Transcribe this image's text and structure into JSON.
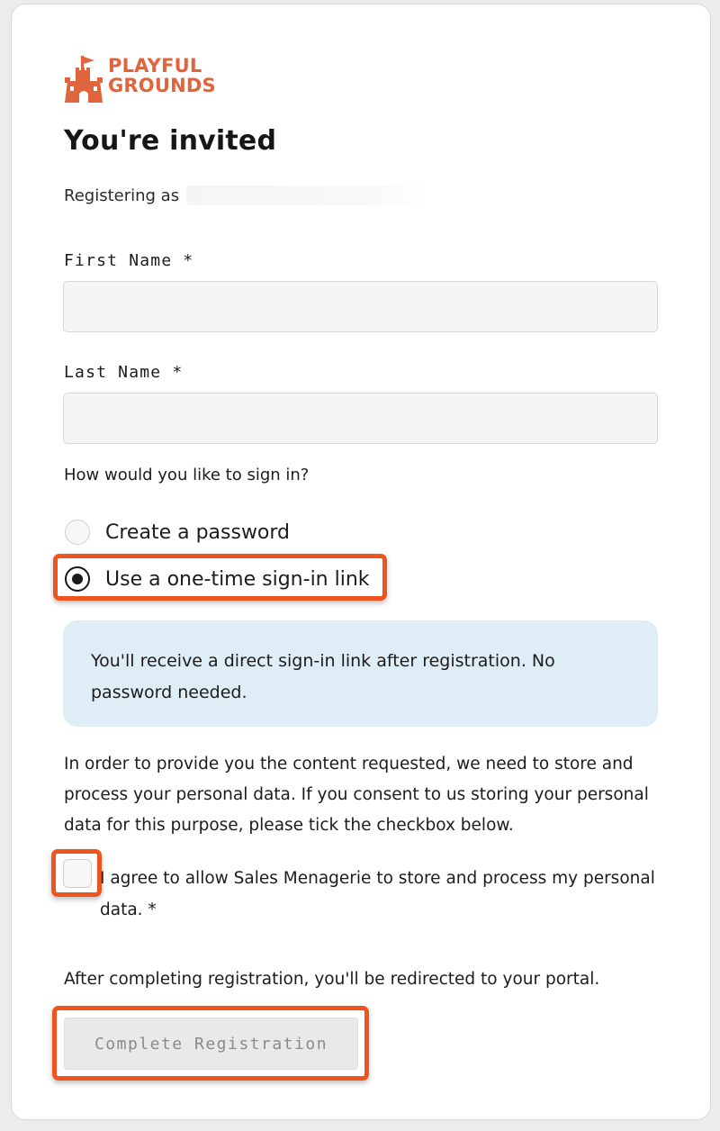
{
  "brand": {
    "logo_line1": "PLAYFUL",
    "logo_line2": "GROUNDS",
    "color": "#e0643c",
    "logo_icon": "castle-flag-icon"
  },
  "header": {
    "title": "You're invited",
    "registering_as_label": "Registering as"
  },
  "form": {
    "first_name": {
      "label": "First Name *",
      "value": "",
      "placeholder": ""
    },
    "last_name": {
      "label": "Last Name *",
      "value": "",
      "placeholder": ""
    },
    "signin_question": "How would you like to sign in?",
    "signin_options": [
      {
        "label": "Create a password",
        "selected": false
      },
      {
        "label": "Use a one-time sign-in link",
        "selected": true
      }
    ],
    "info_message": "You'll receive a direct sign-in link after registration. No password needed.",
    "consent_text": "In order to provide you the content requested, we need to store and process your personal data. If you consent to us storing your personal data for this purpose, please tick the checkbox below.",
    "consent_checkbox_label": "I agree to allow Sales Menagerie to store and process my personal data. *",
    "consent_checked": false,
    "redirect_note": "After completing registration, you'll be redirected to your portal.",
    "submit_label": "Complete Registration"
  },
  "colors": {
    "highlight": "#f0541e",
    "info_bg": "#dfedf7",
    "input_bg": "#f5f5f5",
    "button_disabled_bg": "#e9e9e9"
  }
}
